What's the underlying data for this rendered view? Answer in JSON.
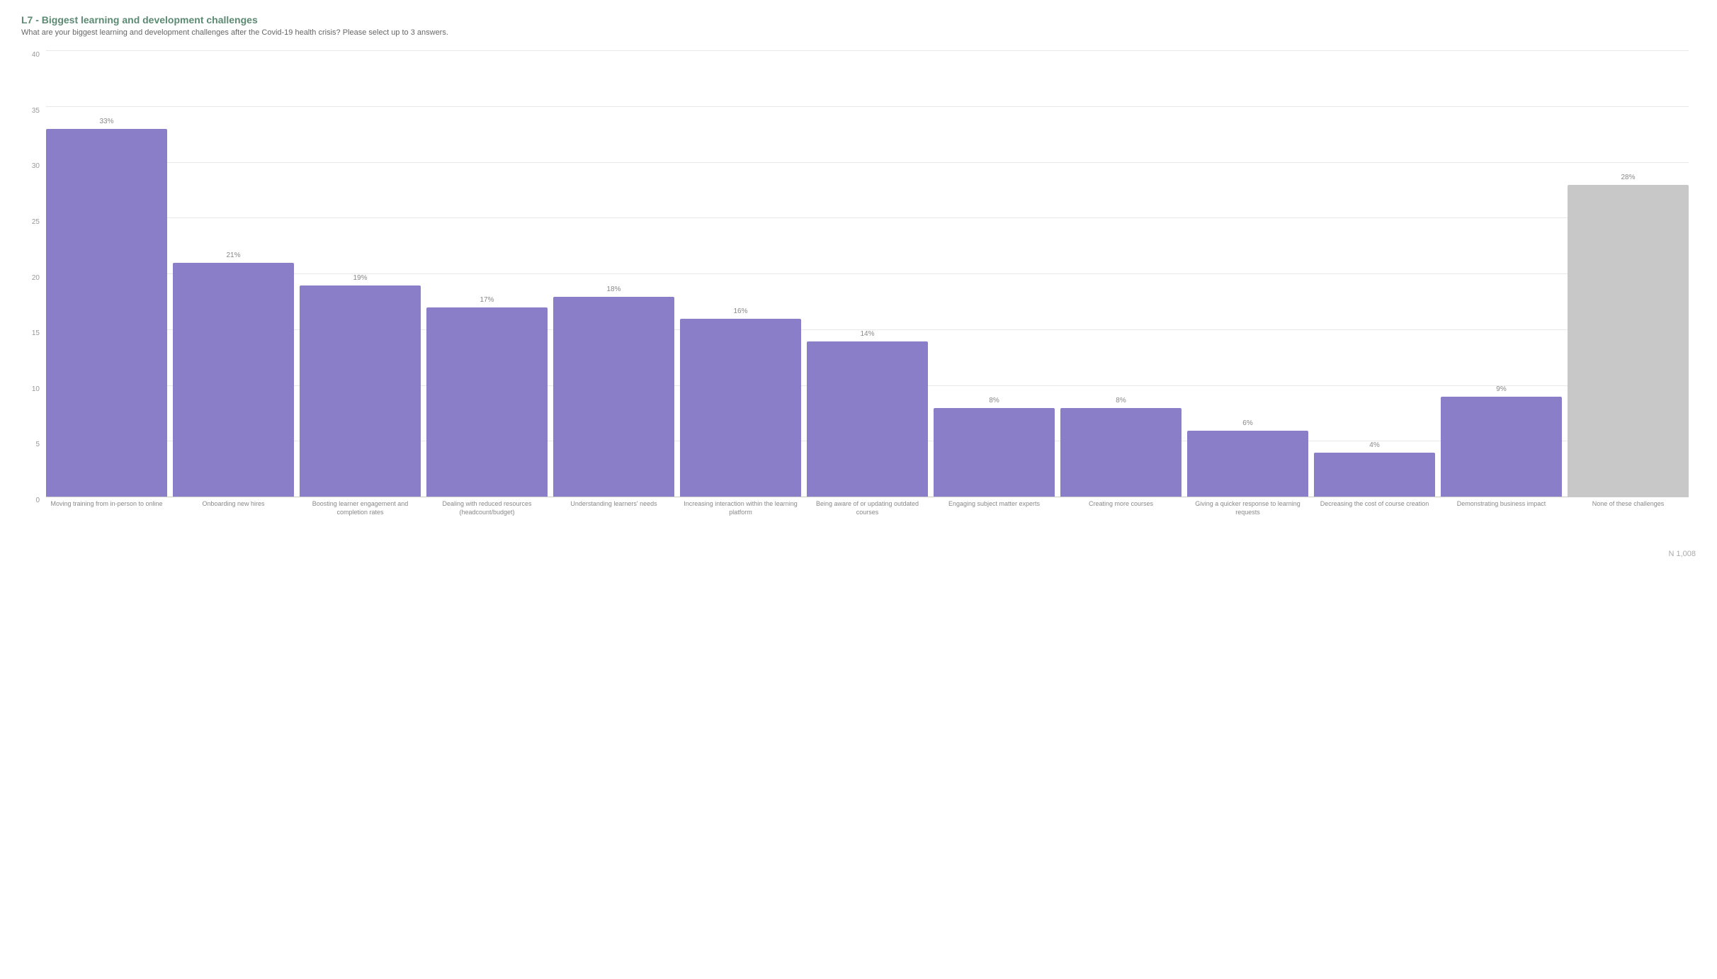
{
  "title": "L7 - Biggest learning and development challenges",
  "subtitle": "What are your biggest learning and development challenges after the Covid-19 health crisis? Please select up to 3 answers.",
  "n_label": "N 1,008",
  "y_axis": {
    "max": 40,
    "labels": [
      "0",
      "5",
      "10",
      "15",
      "20",
      "25",
      "30",
      "35",
      "40"
    ]
  },
  "bars": [
    {
      "label": "Moving training from in-person to online",
      "value": 33,
      "color": "purple"
    },
    {
      "label": "Onboarding new hires",
      "value": 21,
      "color": "purple"
    },
    {
      "label": "Boosting learner engagement and completion rates",
      "value": 19,
      "color": "purple"
    },
    {
      "label": "Dealing with reduced resources (headcount/budget)",
      "value": 17,
      "color": "purple"
    },
    {
      "label": "Understanding learners' needs",
      "value": 18,
      "color": "purple"
    },
    {
      "label": "Increasing interaction within the learning platform",
      "value": 16,
      "color": "purple"
    },
    {
      "label": "Being aware of or updating outdated courses",
      "value": 14,
      "color": "purple"
    },
    {
      "label": "Engaging subject matter experts",
      "value": 8,
      "color": "purple"
    },
    {
      "label": "Creating more courses",
      "value": 8,
      "color": "purple"
    },
    {
      "label": "Giving a quicker response to learning requests",
      "value": 6,
      "color": "purple"
    },
    {
      "label": "Decreasing the cost of course creation",
      "value": 4,
      "color": "purple"
    },
    {
      "label": "Demonstrating business impact",
      "value": 9,
      "color": "purple"
    },
    {
      "label": "None of these challenges",
      "value": 28,
      "color": "gray"
    }
  ]
}
